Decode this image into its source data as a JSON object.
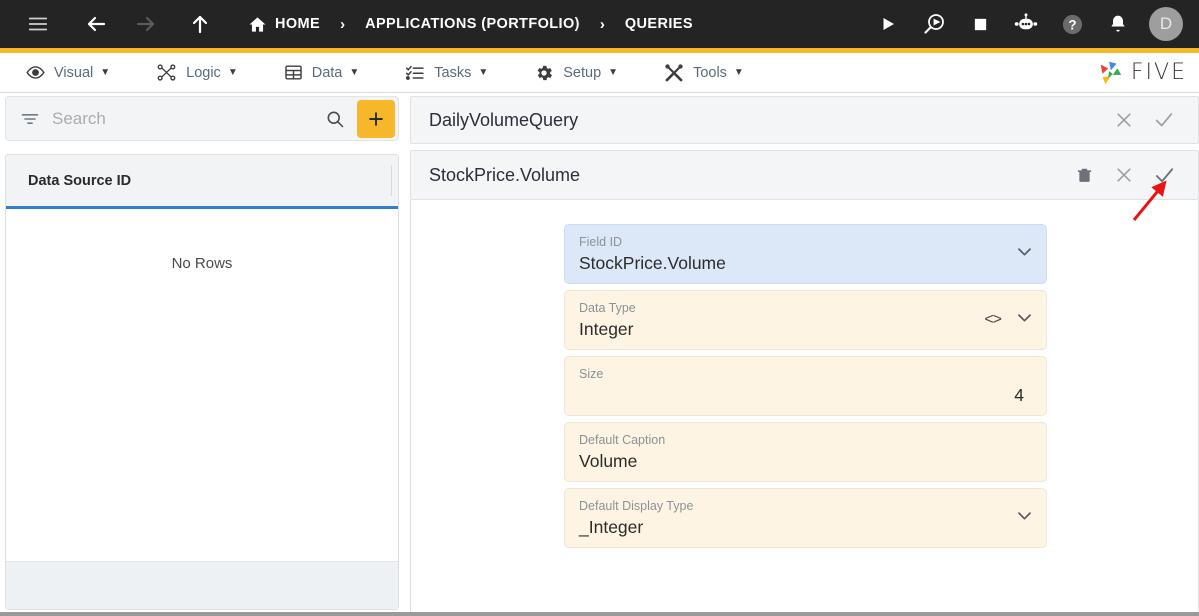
{
  "topbar": {
    "menu_icon": "hamburger-icon",
    "back_icon": "arrow-left-icon",
    "forward_icon": "arrow-right-icon",
    "up_icon": "arrow-up-icon",
    "breadcrumbs": [
      {
        "label": "HOME",
        "icon": "home-icon"
      },
      {
        "label": "APPLICATIONS (PORTFOLIO)",
        "icon": ""
      },
      {
        "label": "QUERIES",
        "icon": ""
      }
    ],
    "separator": "›",
    "actions": [
      {
        "name": "run-icon"
      },
      {
        "name": "debug-icon"
      },
      {
        "name": "stop-icon"
      },
      {
        "name": "chatbot-icon"
      },
      {
        "name": "help-icon"
      },
      {
        "name": "notifications-icon"
      }
    ],
    "avatar_initial": "D",
    "accent_color": "#f6b82a",
    "bg_color": "#242424"
  },
  "menubar": {
    "items": [
      {
        "label": "Visual",
        "icon": "eye-icon",
        "caret": "▼"
      },
      {
        "label": "Logic",
        "icon": "nodes-icon",
        "caret": "▼"
      },
      {
        "label": "Data",
        "icon": "table-icon",
        "caret": "▼"
      },
      {
        "label": "Tasks",
        "icon": "checklist-icon",
        "caret": "▼"
      },
      {
        "label": "Setup",
        "icon": "gear-icon",
        "caret": "▼"
      },
      {
        "label": "Tools",
        "icon": "tools-icon",
        "caret": "▼"
      }
    ],
    "logo_text": "FIVE",
    "logo_colors": [
      "#4285f4",
      "#ea4335",
      "#fbbc05",
      "#34a853"
    ]
  },
  "left_panel": {
    "search": {
      "placeholder": "Search",
      "value": "",
      "filter_icon": "filter-icon",
      "search_icon": "search-icon"
    },
    "add_button": {
      "label": "+",
      "icon": "plus-icon",
      "color": "#f6b82a"
    },
    "grid": {
      "columns": [
        "Data Source ID"
      ],
      "rows": [],
      "empty_message": "No Rows",
      "header_underline_color": "#2f7fd4"
    }
  },
  "right_panel": {
    "query_header": {
      "title": "DailyVolumeQuery",
      "actions": [
        {
          "name": "close-icon",
          "glyph": "✕"
        },
        {
          "name": "confirm-icon",
          "glyph": "✓"
        }
      ]
    },
    "field_header": {
      "title": "StockPrice.Volume",
      "actions": [
        {
          "name": "delete-icon",
          "glyph": "🗑"
        },
        {
          "name": "close-icon",
          "glyph": "✕"
        },
        {
          "name": "confirm-icon",
          "glyph": "✓"
        }
      ]
    },
    "fields": [
      {
        "label": "Field ID",
        "value": "StockPrice.Volume",
        "style": "blue",
        "chevron": true,
        "code_icon": false,
        "align": "left"
      },
      {
        "label": "Data Type",
        "value": "Integer",
        "style": "cream",
        "chevron": true,
        "code_icon": true,
        "align": "left"
      },
      {
        "label": "Size",
        "value": "4",
        "style": "cream",
        "chevron": false,
        "code_icon": false,
        "align": "right"
      },
      {
        "label": "Default Caption",
        "value": "Volume",
        "style": "cream",
        "chevron": false,
        "code_icon": false,
        "align": "left"
      },
      {
        "label": "Default Display Type",
        "value": "_Integer",
        "style": "cream",
        "chevron": true,
        "code_icon": false,
        "align": "left"
      }
    ]
  },
  "annotation": {
    "arrow_color": "#e81313",
    "points_to": "confirm-icon"
  }
}
